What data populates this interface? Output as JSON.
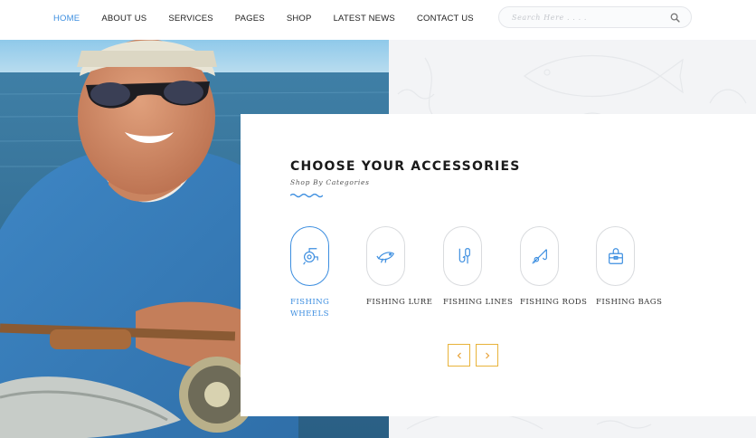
{
  "nav": {
    "items": [
      "HOME",
      "ABOUT US",
      "SERVICES",
      "PAGES",
      "SHOP",
      "LATEST NEWS",
      "CONTACT US"
    ],
    "active": "HOME"
  },
  "search": {
    "placeholder": "Search Here . . . .",
    "icon": "search-icon"
  },
  "hero": {
    "alt": "Fisherman in sunglasses and cap holding a fish and fishing rod"
  },
  "section": {
    "title": "CHOOSE YOUR ACCESSORIES",
    "subtitle": "Shop By Categories",
    "categories": [
      {
        "label": "FISHING WHEELS",
        "icon": "fishing-reel-icon",
        "active": true
      },
      {
        "label": "FISHING LURE",
        "icon": "fishing-lure-icon",
        "active": false
      },
      {
        "label": "FISHING LINES",
        "icon": "fishing-line-icon",
        "active": false
      },
      {
        "label": "FISHING RODS",
        "icon": "fishing-rod-icon",
        "active": false
      },
      {
        "label": "FISHING BAGS",
        "icon": "fishing-bag-icon",
        "active": false
      }
    ],
    "prev_icon": "chevron-left-icon",
    "next_icon": "chevron-right-icon"
  },
  "colors": {
    "accent": "#3c8ee0",
    "arrow_border": "#e8b33a",
    "text": "#222222",
    "card_bg": "#ffffff"
  }
}
